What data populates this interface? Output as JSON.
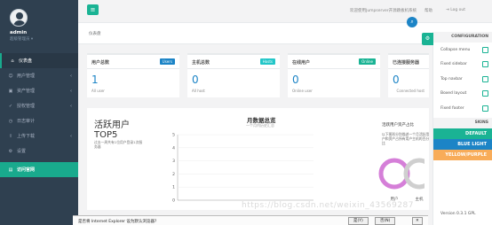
{
  "sidebar": {
    "username": "admin",
    "role": "超级管理员 ▾",
    "items": [
      {
        "icon": "⌂",
        "label": "仪表盘",
        "arrow": ""
      },
      {
        "icon": "☺",
        "label": "用户管理",
        "arrow": "‹"
      },
      {
        "icon": "▣",
        "label": "资产管理",
        "arrow": "‹"
      },
      {
        "icon": "✓",
        "label": "授权管理",
        "arrow": "‹"
      },
      {
        "icon": "◷",
        "label": "日志审计",
        "arrow": ""
      },
      {
        "icon": "⇧",
        "label": "上传下载",
        "arrow": "‹"
      },
      {
        "icon": "⚙",
        "label": "设置",
        "arrow": ""
      },
      {
        "icon": "▤",
        "label": "访问官网",
        "arrow": ""
      }
    ]
  },
  "topbar": {
    "menu_icon": "≡",
    "welcome": "欢迎使用Jumpserver开源跳板机系统",
    "help": "帮助",
    "logout": "⇥ Log out"
  },
  "breadcrumb": {
    "title": "仪表盘"
  },
  "cards": [
    {
      "title": "用户总数",
      "label": "Users",
      "value": "1",
      "sub": "All user",
      "subr": "",
      "label_color": "#1c84c6"
    },
    {
      "title": "主机总数",
      "label": "Hosts",
      "value": "0",
      "sub": "All host",
      "subr": "",
      "label_color": "#23c6c8"
    },
    {
      "title": "在线用户",
      "label": "Online",
      "value": "0",
      "sub": "Online user",
      "subr": "",
      "label_color": "#1ab394"
    },
    {
      "title": "已连接服务器",
      "label": "",
      "value": "0",
      "sub": "",
      "subr": "Connected host",
      "label_color": "#f8ac59"
    }
  ],
  "activity": {
    "title": "活跃用户",
    "top": "TOP5",
    "desc": "过去一周共有1位用户登录1次服务器"
  },
  "chart_data": {
    "type": "line",
    "title": "月数据总览",
    "subtitle": "一个月内历史汇总",
    "ylim": [
      0,
      5
    ],
    "yticks": [
      "0",
      "1",
      "2",
      "3",
      "4",
      "5"
    ],
    "series": []
  },
  "pie": {
    "title": "活跃用户资产占比",
    "desc": "以下图形分别描述一个月活跃用户和资产占所有用户主机的百分比",
    "label": "用户",
    "label2": "主机"
  },
  "config": {
    "header": "CONFIGURATION",
    "options": [
      "Collapse menu",
      "Fixed sidebar",
      "Top navbar",
      "Boxed layout",
      "Fixed footer"
    ],
    "skins_header": "SKINS",
    "skins": [
      {
        "name": "DEFAULT",
        "color": "#1ab394",
        "textcolor": "#ffffff"
      },
      {
        "name": "BLUE LIGHT",
        "color": "#1c84c6",
        "textcolor": "#ffffff"
      },
      {
        "name": "YELLOW/PURPLE",
        "color": "#f8ac59",
        "textcolor": "#ffffff"
      }
    ],
    "version": "Version 0.3.1 GPL",
    "gear_icon": "⚙"
  },
  "iebar": {
    "question": "是否将 Internet Explorer 设为默认浏览器?",
    "yes": "是(Y)",
    "no": "否(N)",
    "close": "✕"
  },
  "watermark": "https://blog.csdn.net/weixin_43569287",
  "float_icon": "⌕"
}
